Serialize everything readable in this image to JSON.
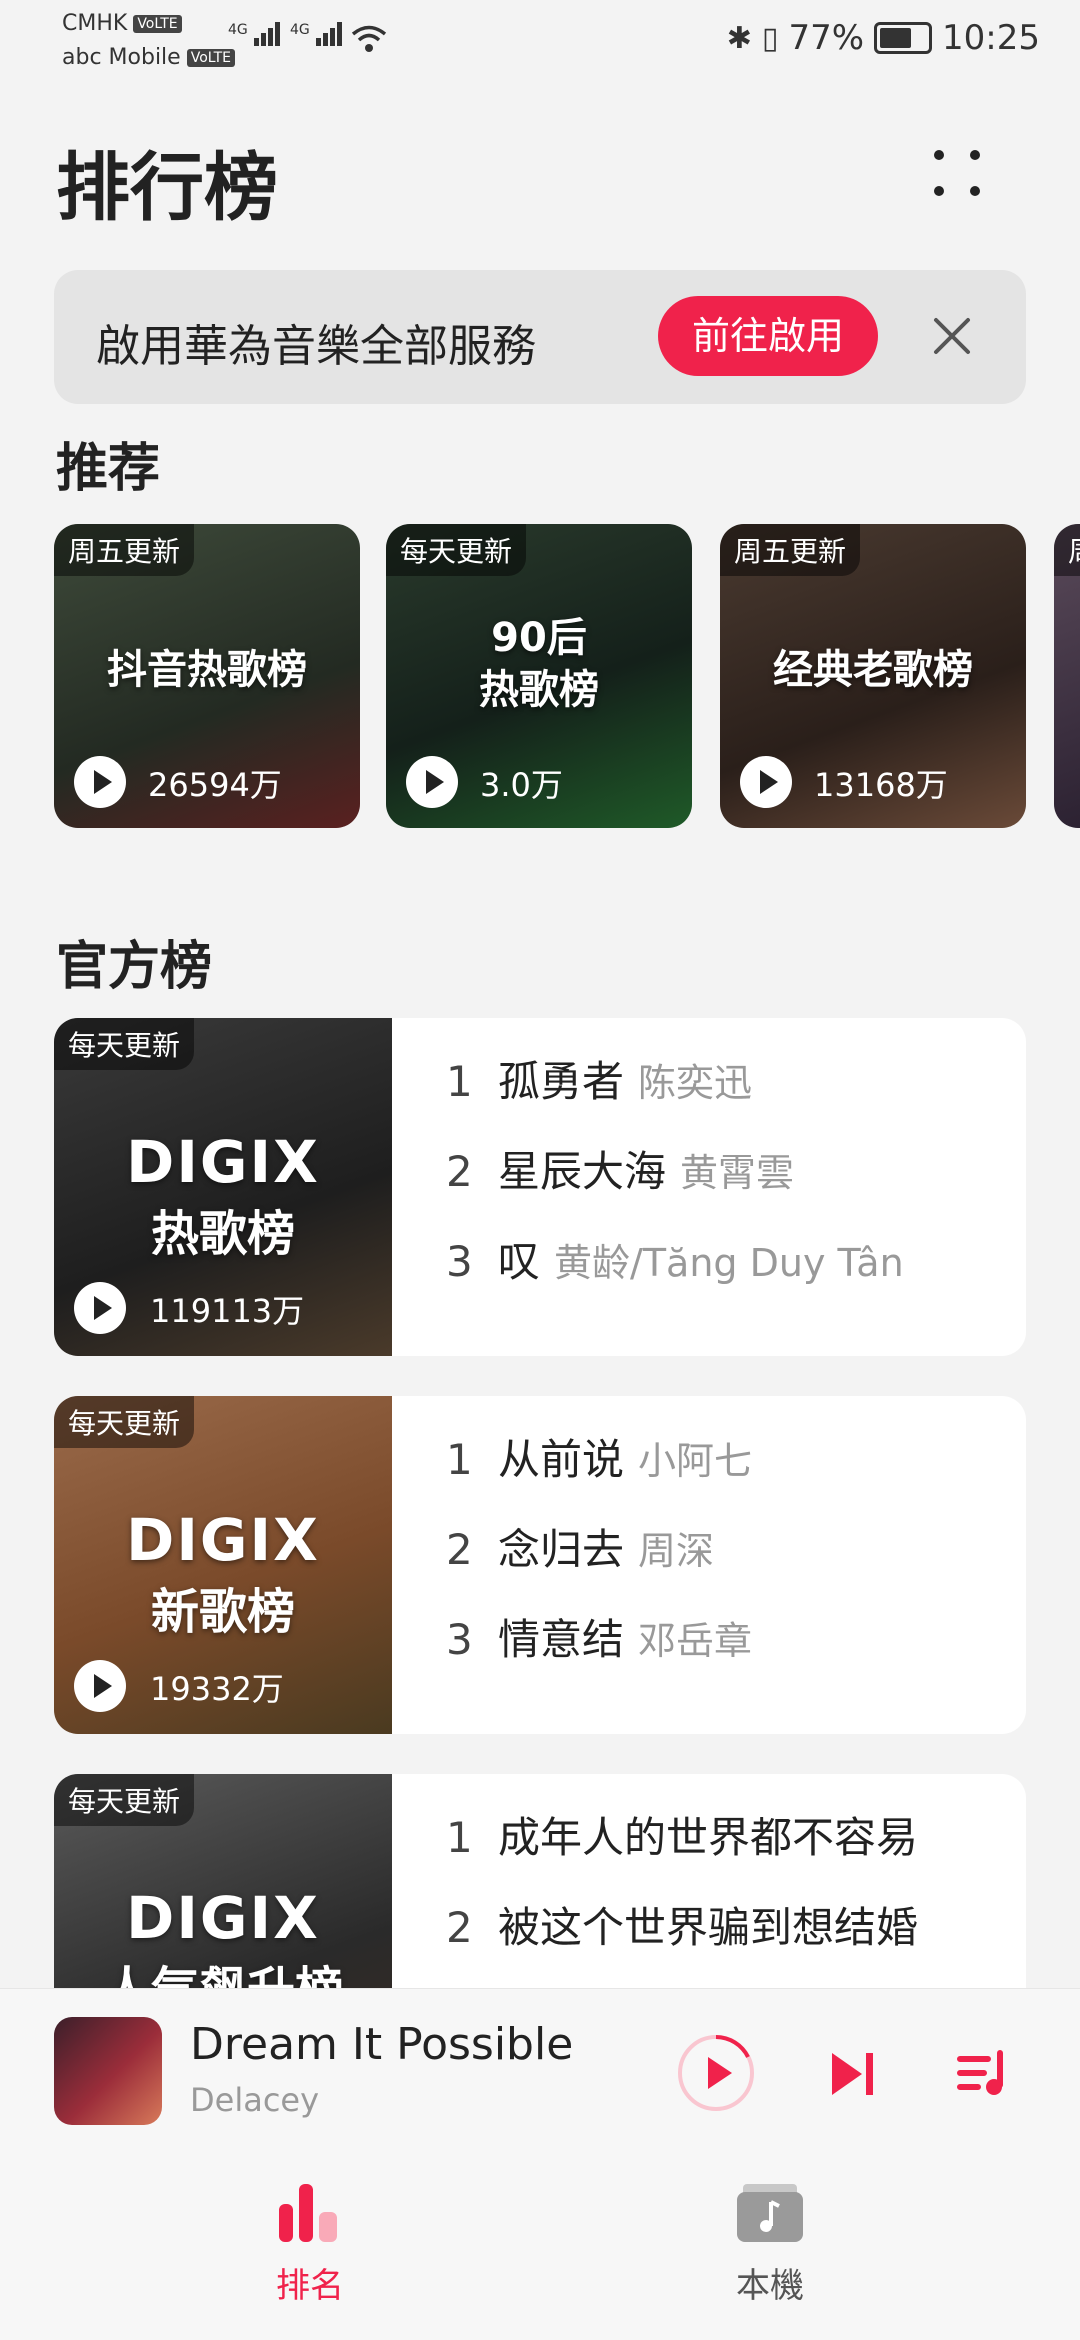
{
  "status_bar": {
    "carrier1": "CMHK",
    "carrier2": "abc Mobile",
    "volte": "VoLTE",
    "net": "4G",
    "battery_pct": "77%",
    "battery_level": 0.77,
    "time": "10:25"
  },
  "header": {
    "title": "排行榜"
  },
  "banner": {
    "text": "啟用華為音樂全部服務",
    "button": "前往啟用"
  },
  "recommended": {
    "title": "推荐",
    "cards": [
      {
        "tag": "周五更新",
        "title": "抖音热歌榜",
        "count": "26594万",
        "bg": "#2f3a2d"
      },
      {
        "tag": "每天更新",
        "title_line1": "90后",
        "title_line2": "热歌榜",
        "count": "3.0万",
        "bg": "#1d2a20"
      },
      {
        "tag": "周五更新",
        "title": "经典老歌榜",
        "count": "13168万",
        "bg": "#3a2a22"
      },
      {
        "tag": "周"
      }
    ]
  },
  "official": {
    "title": "官方榜",
    "charts": [
      {
        "tag": "每天更新",
        "brand": "DIGIX",
        "name": "热歌榜",
        "count": "119113万",
        "bg": "#2a2a2a",
        "tracks": [
          {
            "num": "1",
            "song": "孤勇者",
            "artist": "陈奕迅"
          },
          {
            "num": "2",
            "song": "星辰大海",
            "artist": "黄霄雲"
          },
          {
            "num": "3",
            "song": "叹",
            "artist": "黄龄/Tăng Duy Tân"
          }
        ]
      },
      {
        "tag": "每天更新",
        "brand": "DIGIX",
        "name": "新歌榜",
        "count": "19332万",
        "bg": "#8a5a3a",
        "tracks": [
          {
            "num": "1",
            "song": "从前说",
            "artist": "小阿七"
          },
          {
            "num": "2",
            "song": "念归去",
            "artist": "周深"
          },
          {
            "num": "3",
            "song": "情意结",
            "artist": "邓岳章"
          }
        ]
      },
      {
        "tag": "每天更新",
        "brand": "DIGIX",
        "name": "人气飙升榜",
        "bg": "#3a3a3a",
        "tracks": [
          {
            "num": "1",
            "song": "成年人的世界都不容易"
          },
          {
            "num": "2",
            "song": "被这个世界骗到想结婚"
          }
        ]
      }
    ]
  },
  "player": {
    "title": "Dream It Possible",
    "artist": "Delacey"
  },
  "nav": {
    "items": [
      {
        "label": "排名"
      },
      {
        "label": "本機"
      }
    ]
  },
  "colors": {
    "accent": "#f0224b",
    "background": "#f3f3f3"
  }
}
